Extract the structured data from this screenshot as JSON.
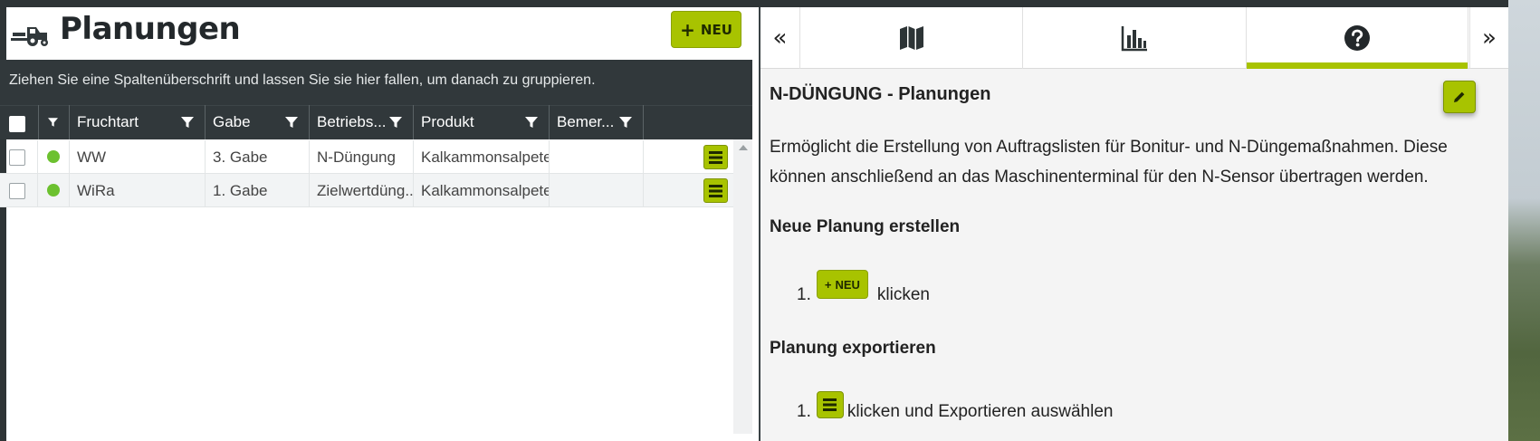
{
  "app": {
    "title": "Planungen",
    "new_button_label": "NEU",
    "group_hint": "Ziehen Sie eine Spaltenüberschrift und lassen Sie sie hier fallen, um danach zu gruppieren."
  },
  "grid": {
    "columns": [
      "Fruchtart",
      "Gabe",
      "Betriebs...",
      "Produkt",
      "Bemer..."
    ],
    "rows": [
      {
        "status_color": "#6cc12f",
        "fruchtart": "WW",
        "gabe": "3. Gabe",
        "betrieb": "N-Düngung",
        "produkt": "Kalkammonsalpeter",
        "bemerkung": ""
      },
      {
        "status_color": "#6cc12f",
        "fruchtart": "WiRa",
        "gabe": "1. Gabe",
        "betrieb": "Zielwertdüng...",
        "produkt": "Kalkammonsalpeter",
        "bemerkung": ""
      }
    ]
  },
  "side_panel": {
    "tabs": [
      {
        "icon": "map-icon"
      },
      {
        "icon": "bar-chart-icon"
      },
      {
        "icon": "help-icon",
        "active": true
      }
    ],
    "collapse_left": "«",
    "collapse_right": "»",
    "help": {
      "title": "N-DÜNGUNG - Planungen",
      "intro": "Ermöglicht die Erstellung von Auftragslisten für Bonitur- und N-Düngemaßnahmen. Diese können anschließend an das Maschinenterminal für den N-Sensor übertragen werden.",
      "section1_title": "Neue Planung erstellen",
      "section1_step_num": "1.",
      "section1_button": "NEU",
      "section1_step_text": "klicken",
      "section2_title": "Planung exportieren",
      "section2_step_num": "1.",
      "section2_step_text": "klicken und Exportieren auswählen"
    }
  },
  "colors": {
    "accent": "#a8c300",
    "dark": "#31383b",
    "status_ok": "#6cc12f"
  }
}
